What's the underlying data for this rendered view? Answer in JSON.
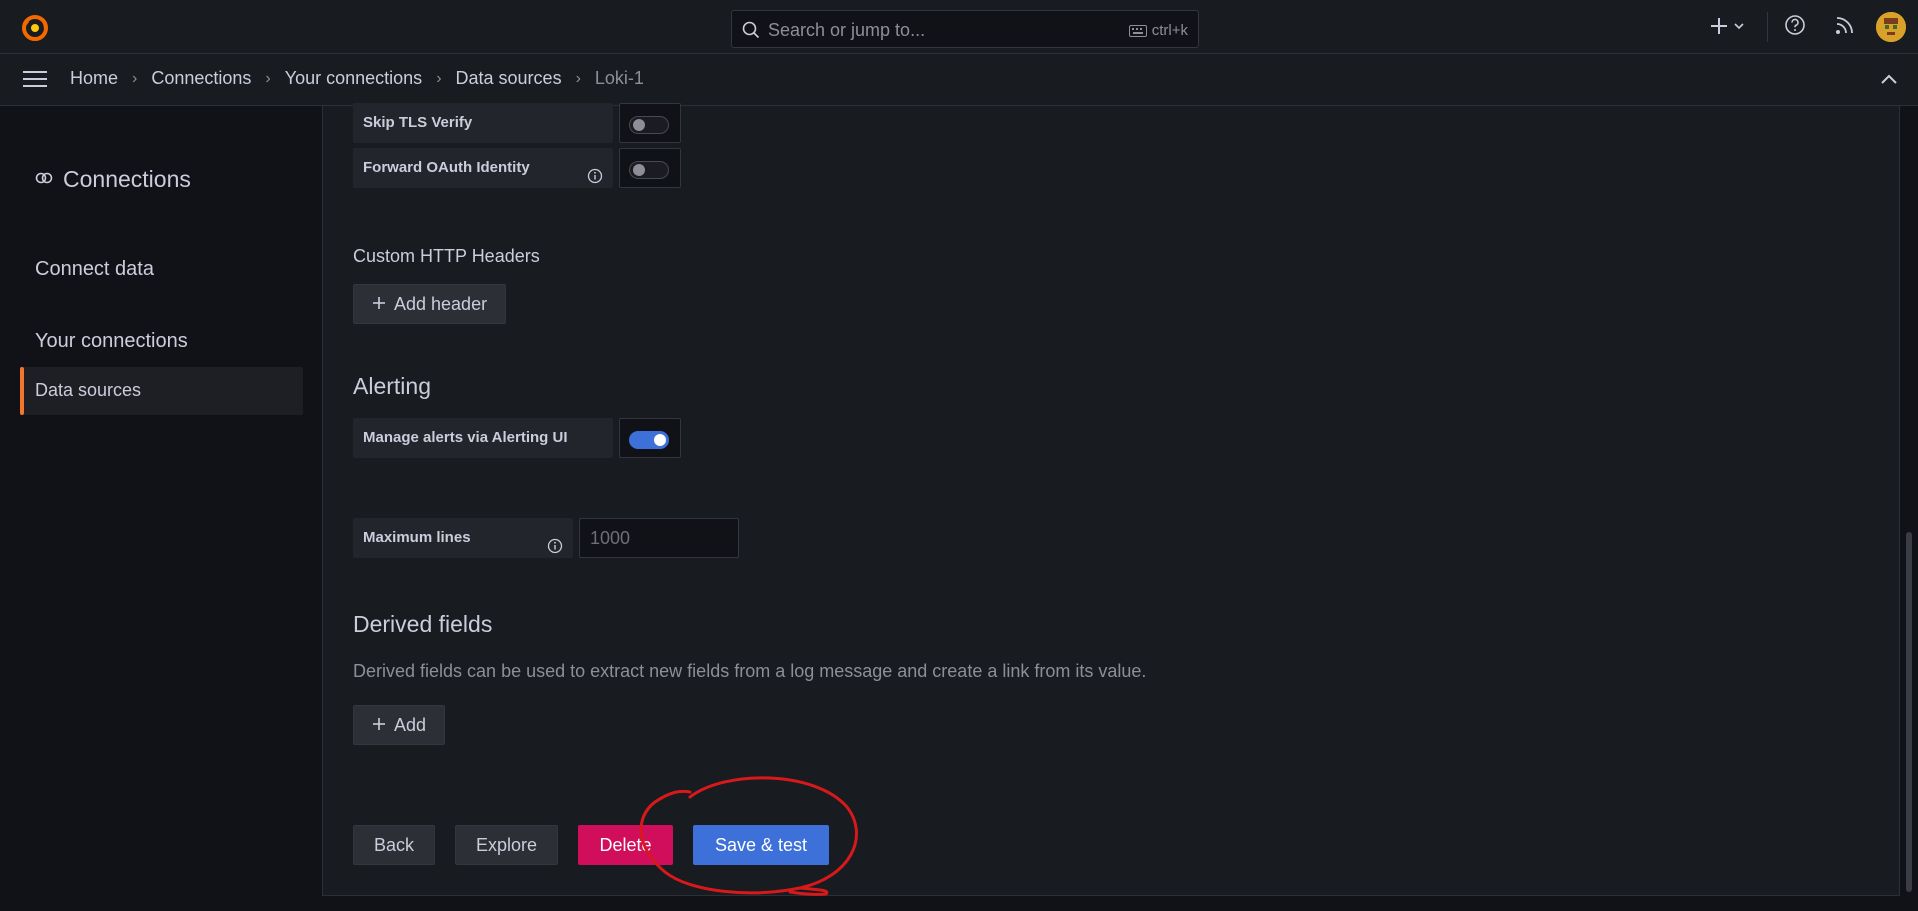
{
  "topbar": {
    "search_placeholder": "Search or jump to...",
    "search_shortcut": "ctrl+k"
  },
  "breadcrumb": [
    "Home",
    "Connections",
    "Your connections",
    "Data sources",
    "Loki-1"
  ],
  "sidebar": {
    "title": "Connections",
    "items": [
      "Connect data",
      "Your connections"
    ],
    "active_item": "Data sources"
  },
  "auth": {
    "skip_tls_label": "Skip TLS Verify",
    "skip_tls_enabled": false,
    "forward_oauth_label": "Forward OAuth Identity",
    "forward_oauth_enabled": false
  },
  "custom_headers": {
    "title": "Custom HTTP Headers",
    "add_label": "Add header"
  },
  "alerting": {
    "title": "Alerting",
    "manage_label": "Manage alerts via Alerting UI",
    "manage_enabled": true
  },
  "max_lines": {
    "label": "Maximum lines",
    "placeholder": "1000"
  },
  "derived_fields": {
    "title": "Derived fields",
    "description": "Derived fields can be used to extract new fields from a log message and create a link from its value.",
    "add_label": "Add"
  },
  "actions": {
    "back": "Back",
    "explore": "Explore",
    "delete": "Delete",
    "save_test": "Save & test"
  },
  "colors": {
    "accent": "#3d71d9",
    "danger": "#d10e5c",
    "active_marker": "#f2772a",
    "annotation": "#d7191c"
  },
  "icons": [
    "grafana-logo-icon",
    "search-icon",
    "keyboard-icon",
    "plus-icon",
    "chevron-down-icon",
    "help-icon",
    "rss-icon",
    "menu-icon",
    "chevron-up-icon",
    "connections-icon",
    "info-icon"
  ]
}
